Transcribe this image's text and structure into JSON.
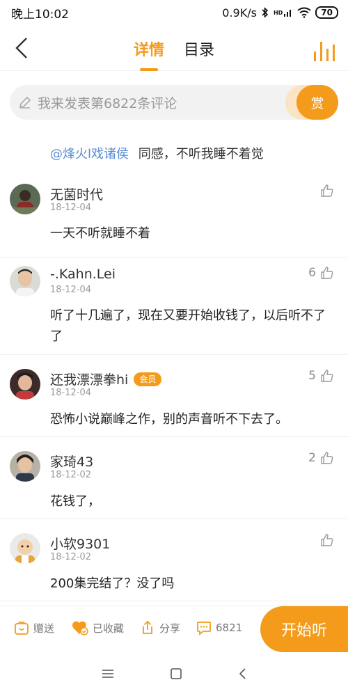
{
  "status_bar": {
    "time": "晚上10:02",
    "net_speed": "0.9K/s",
    "hd_label": "HD",
    "battery": "70"
  },
  "nav": {
    "tabs": [
      {
        "label": "详情",
        "active": true
      },
      {
        "label": "目录",
        "active": false
      }
    ]
  },
  "comment_input": {
    "placeholder": "我来发表第6822条评论",
    "reward_label": "赏"
  },
  "reply": {
    "mention": "@烽火l戏诸侯",
    "text": "同感，不听我睡不着觉"
  },
  "comments": [
    {
      "user": "无菌时代",
      "date": "18-12-04",
      "text": "一天不听就睡不着",
      "likes": "",
      "badge": ""
    },
    {
      "user": "-.Kahn.Lei",
      "date": "18-12-04",
      "text": "听了十几遍了，现在又要开始收钱了，以后听不了了",
      "likes": "6",
      "badge": ""
    },
    {
      "user": "还我漂漂拳hi",
      "date": "18-12-04",
      "text": "恐怖小说巅峰之作，别的声音听不下去了。",
      "likes": "5",
      "badge": "会员"
    },
    {
      "user": "家琦43",
      "date": "18-12-02",
      "text": "花钱了，",
      "likes": "2",
      "badge": ""
    },
    {
      "user": "小软9301",
      "date": "18-12-02",
      "text": "200集完结了？没了吗",
      "likes": "",
      "badge": ""
    }
  ],
  "bottom_bar": {
    "gift": "赠送",
    "collected": "已收藏",
    "share": "分享",
    "comments": "6821",
    "start": "开始听"
  },
  "colors": {
    "accent": "#f49b1c",
    "mention": "#5a8ed8"
  }
}
